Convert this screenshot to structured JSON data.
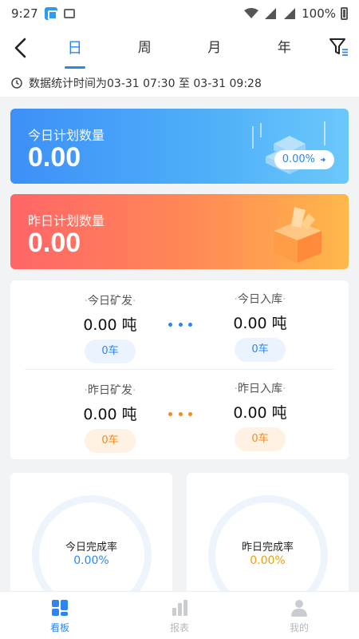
{
  "status_bar": {
    "time": "9:27",
    "battery": "100%"
  },
  "nav": {
    "tabs": [
      {
        "label": "日",
        "active": true
      },
      {
        "label": "周",
        "active": false
      },
      {
        "label": "月",
        "active": false
      },
      {
        "label": "年",
        "active": false
      }
    ]
  },
  "time_range": {
    "text": "数据统计时间为03-31 07:30 至 03-31 09:28"
  },
  "plan": {
    "today": {
      "label": "今日计划数量",
      "value": "0.00",
      "percent": "0.00%"
    },
    "yesterday": {
      "label": "昨日计划数量",
      "value": "0.00"
    }
  },
  "transport": {
    "today_mined": {
      "label": "今日矿发",
      "amount": "0.00 吨",
      "trucks": "0车"
    },
    "today_stored": {
      "label": "今日入库",
      "amount": "0.00 吨",
      "trucks": "0车"
    },
    "yesterday_mined": {
      "label": "昨日矿发",
      "amount": "0.00 吨",
      "trucks": "0车"
    },
    "yesterday_stored": {
      "label": "昨日入库",
      "amount": "0.00 吨",
      "trucks": "0车"
    }
  },
  "rates": {
    "today": {
      "label": "今日完成率",
      "value": "0.00%"
    },
    "yesterday": {
      "label": "昨日完成率",
      "value": "0.00%"
    }
  },
  "bottom_tabs": [
    {
      "label": "看板",
      "icon": "dashboard-icon",
      "active": true
    },
    {
      "label": "报表",
      "icon": "bar-chart-icon",
      "active": false
    },
    {
      "label": "我的",
      "icon": "user-icon",
      "active": false
    }
  ],
  "colors": {
    "accent": "#2d86f0",
    "warning": "#f58a1f",
    "rate_yesterday": "#e8a20b"
  }
}
